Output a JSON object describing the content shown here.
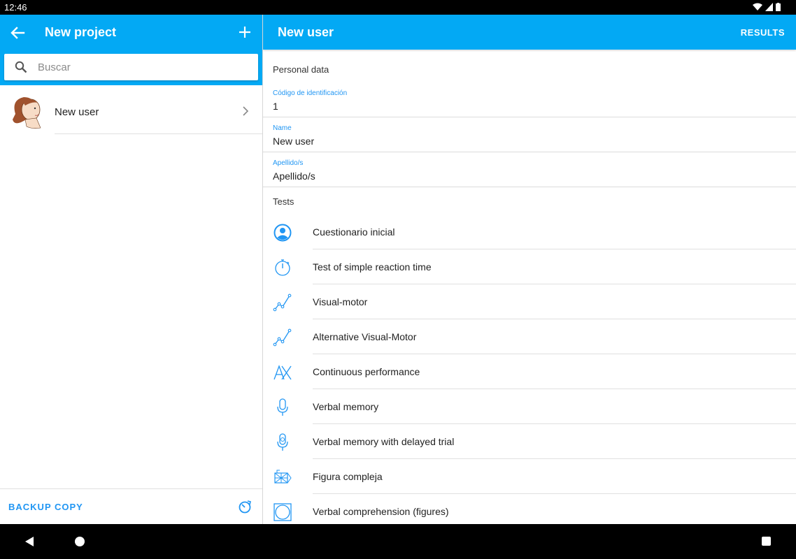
{
  "status_bar": {
    "time": "12:46"
  },
  "left_pane": {
    "title": "New project",
    "search": {
      "placeholder": "Buscar",
      "value": ""
    },
    "users": [
      {
        "label": "New user"
      }
    ],
    "backup_label": "BACKUP COPY"
  },
  "right_pane": {
    "title": "New user",
    "results_label": "RESULTS",
    "personal_header": "Personal data",
    "fields": [
      {
        "label": "Código de identificación",
        "value": "1"
      },
      {
        "label": "Name",
        "value": "New user"
      },
      {
        "label": "Apellido/s",
        "value": "Apellido/s"
      }
    ],
    "tests_header": "Tests",
    "tests": [
      {
        "label": "Cuestionario inicial",
        "icon": "account-circle-icon"
      },
      {
        "label": "Test of simple reaction time",
        "icon": "stopwatch-icon"
      },
      {
        "label": "Visual-motor",
        "icon": "line-graph-icon"
      },
      {
        "label": "Alternative Visual-Motor",
        "icon": "line-graph-icon"
      },
      {
        "label": "Continuous performance",
        "icon": "ax-letters-icon"
      },
      {
        "label": "Verbal memory",
        "icon": "microphone-icon"
      },
      {
        "label": "Verbal memory with delayed trial",
        "icon": "microphone-clock-icon"
      },
      {
        "label": "Figura compleja",
        "icon": "complex-figure-icon"
      },
      {
        "label": "Verbal comprehension (figures)",
        "icon": "circle-square-icon"
      }
    ]
  },
  "colors": {
    "primary": "#03a9f4",
    "accent": "#2196f3"
  }
}
